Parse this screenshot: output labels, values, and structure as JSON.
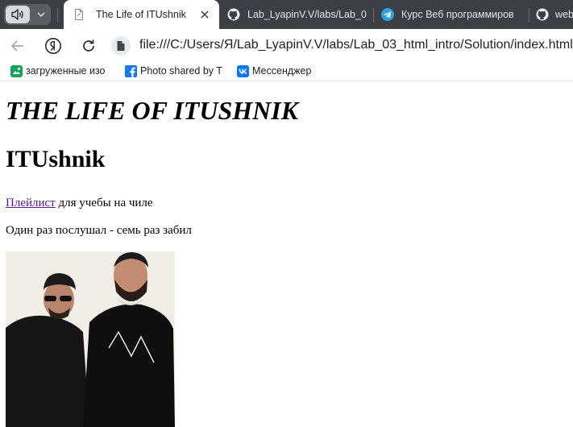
{
  "browser": {
    "tabs": [
      {
        "title": "The Life of ITUshnik",
        "icon": "file-icon",
        "active": true
      },
      {
        "title": "Lab_LyapinV.V/labs/Lab_0",
        "icon": "github-icon",
        "active": false
      },
      {
        "title": "Курс Веб программиров",
        "icon": "telegram-icon",
        "active": false
      },
      {
        "title": "web",
        "icon": "github-icon",
        "active": false
      }
    ],
    "url": "file:///C:/Users/Я/Lab_LyapinV.V/labs/Lab_03_html_intro/Solution/index.html",
    "bookmarks": [
      {
        "label": "загруженные изо",
        "icon": "image-bookmark-icon",
        "color": "#17a35a"
      },
      {
        "label": "Photo shared by T",
        "icon": "facebook-icon",
        "color": "#1877f2"
      },
      {
        "label": "Мессенджер",
        "icon": "vk-icon",
        "color": "#0077ff"
      }
    ]
  },
  "page": {
    "title": "THE LIFE OF ITUSHNIK",
    "subtitle": "ITUshnik",
    "playlist_link": "Плейлист",
    "playlist_rest": " для учебы на чиле",
    "quote": "Один раз послушал - семь раз забил"
  },
  "colors": {
    "tabstrip": "#3c3f44",
    "active_tab": "#ffffff",
    "visited_link": "#551a8b"
  }
}
